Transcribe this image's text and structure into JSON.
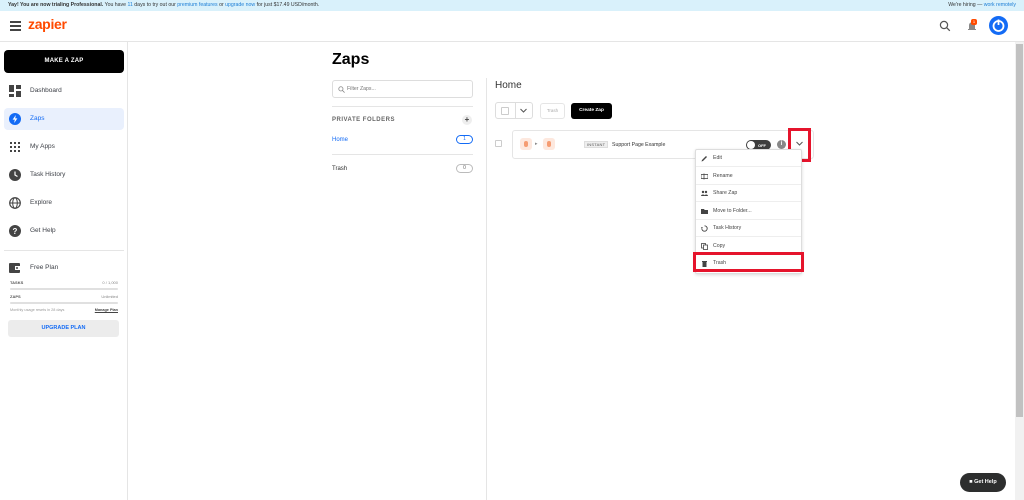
{
  "banner": {
    "pre": "Yay! You are now trialing Professional.",
    "mid1": " You have ",
    "days": "11",
    "mid2": " days to try out our ",
    "link1": "premium features",
    "mid3": " or ",
    "link2": "upgrade now",
    "post": " for just $17.49 USD/month.",
    "right_text": "We're hiring — ",
    "right_link": "work remotely"
  },
  "topbar": {
    "logo": "zapier",
    "notif_count": "1"
  },
  "sidebar": {
    "make_zap": "MAKE A ZAP",
    "items": [
      {
        "label": "Dashboard",
        "icon": "dashboard-icon"
      },
      {
        "label": "Zaps",
        "icon": "zap-icon"
      },
      {
        "label": "My Apps",
        "icon": "apps-grid-icon"
      },
      {
        "label": "Task History",
        "icon": "clock-icon"
      },
      {
        "label": "Explore",
        "icon": "globe-icon"
      },
      {
        "label": "Get Help",
        "icon": "help-icon"
      }
    ],
    "plan": {
      "title": "Free Plan",
      "tasks_label": "TASKS",
      "tasks_value": "0 / 1,000",
      "zaps_label": "ZAPS",
      "zaps_value": "Unlimited",
      "usage_note": "Monthly usage resets in 28 days",
      "manage_link": "Manage Plan",
      "upgrade": "UPGRADE PLAN"
    }
  },
  "main": {
    "title": "Zaps",
    "filter_placeholder": "Filter Zaps...",
    "private_folders": "PRIVATE FOLDERS",
    "folders": [
      {
        "name": "Home",
        "count": "1"
      },
      {
        "name": "Trash",
        "count": "0"
      }
    ]
  },
  "content": {
    "title": "Home",
    "trash_btn": "Trash",
    "create_btn": "Create Zap",
    "zap": {
      "badge": "INSTANT",
      "name": "Support Page Example",
      "toggle": "OFF",
      "info": "i"
    },
    "menu": [
      {
        "label": "Edit",
        "icon": "pencil-icon"
      },
      {
        "label": "Rename",
        "icon": "rename-icon"
      },
      {
        "label": "Share Zap",
        "icon": "share-icon"
      },
      {
        "label": "Move to Folder...",
        "icon": "folder-icon"
      },
      {
        "label": "Task History",
        "icon": "history-icon"
      },
      {
        "label": "Copy",
        "icon": "copy-icon"
      },
      {
        "label": "Trash",
        "icon": "trash-icon"
      }
    ]
  },
  "help_button": "Get Help",
  "colors": {
    "accent": "#136bf5",
    "brand": "#ff4a00",
    "highlight": "#e5142c"
  }
}
